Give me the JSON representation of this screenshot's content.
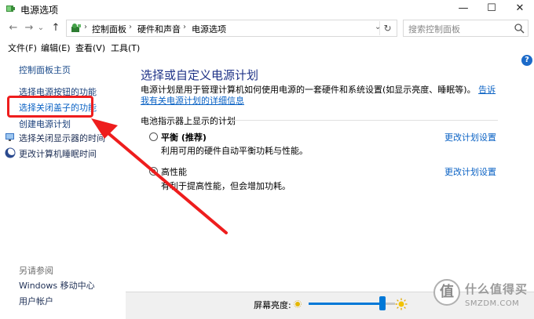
{
  "window": {
    "title": "电源选项",
    "minimize_glyph": "—",
    "maximize_glyph": "☐",
    "close_glyph": "✕"
  },
  "nav": {
    "back_glyph": "←",
    "forward_glyph": "→",
    "recent_glyph": "⌄",
    "up_glyph": "↑",
    "refresh_glyph": "↻",
    "breadcrumb": [
      "控制面板",
      "硬件和声音",
      "电源选项"
    ],
    "dropdown_glyph": "⌄",
    "search_placeholder": "搜索控制面板"
  },
  "menu": {
    "items": [
      "文件(F)",
      "编辑(E)",
      "查看(V)",
      "工具(T)"
    ]
  },
  "help": {
    "glyph": "?"
  },
  "sidebar": {
    "home": "控制面板主页",
    "links": [
      "选择电源按钮的功能",
      "选择关闭盖子的功能",
      "创建电源计划",
      "选择关闭显示器的时间",
      "更改计算机睡眠时间"
    ],
    "see_also_title": "另请参阅",
    "see_also": [
      "Windows 移动中心",
      "用户帐户"
    ]
  },
  "content": {
    "heading": "选择或自定义电源计划",
    "description": "电源计划是用于管理计算机如何使用电源的一套硬件和系统设置(如显示亮度、睡眠等)。",
    "description_link": "告诉我有关电源计划的详细信息",
    "section_label": "电池指示器上显示的计划",
    "plans": [
      {
        "name": "平衡 (推荐)",
        "desc": "利用可用的硬件自动平衡功耗与性能。",
        "link": "更改计划设置",
        "selected": false
      },
      {
        "name": "高性能",
        "desc": "有利于提高性能，但会增加功耗。",
        "link": "更改计划设置",
        "selected": true
      }
    ]
  },
  "brightness": {
    "label": "屏幕亮度:",
    "level_percent": 85
  },
  "watermark": {
    "seal": "值",
    "line1": "什么值得买",
    "line2": "SMZDM.COM"
  },
  "colors": {
    "link_blue": "#0a62c4",
    "heading_blue": "#1e3287",
    "annotation_red": "#ee1d1d",
    "slider_blue": "#0078d7"
  }
}
